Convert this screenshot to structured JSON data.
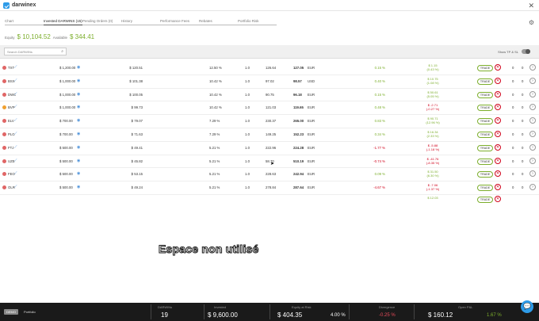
{
  "brand": {
    "name": "darwinex"
  },
  "tabs": [
    {
      "label": "Chart"
    },
    {
      "label": "Invested DARWINS (15)"
    },
    {
      "label": "Pending Orders (0)"
    },
    {
      "label": "History"
    },
    {
      "label": "Performance Fees"
    },
    {
      "label": "Rebates"
    },
    {
      "label": "Portfolio Risk"
    }
  ],
  "equity": {
    "label": "Equity",
    "value": "$ 10,104.52",
    "available_label": "Available",
    "available_value": "$ 344.41"
  },
  "toolbar": {
    "search_placeholder": "Search DARWINs",
    "show_tp_sl": "Show TP & SL"
  },
  "rows": [
    {
      "name": "TXT",
      "color": "#e06666",
      "amount": "$ 1,200.00",
      "invested": "$ 120.51",
      "pct": "12.50 %",
      "lev": "1.0",
      "p1": "126.64",
      "p2": "127.05",
      "ccy": "EUR",
      "perf": "0.15 %",
      "neg": false,
      "pnl1": "$ 1.15",
      "pnl2": "(0.43 %)",
      "c1": "0",
      "c2": "0"
    },
    {
      "name": "BSX",
      "color": "#e06666",
      "amount": "$ 1,000.00",
      "invested": "$ 101.38",
      "pct": "10.42 %",
      "lev": "1.0",
      "p1": "97.02",
      "p2": "98.57",
      "ccy": "USD",
      "perf": "0.40 %",
      "neg": false,
      "pnl1": "$ 10.75",
      "pnl2": "(1.08 %)",
      "c1": "0",
      "c2": "0"
    },
    {
      "name": "DWC",
      "color": "#e06666",
      "amount": "$ 1,000.00",
      "invested": "$ 100.05",
      "pct": "10.42 %",
      "lev": "1.0",
      "p1": "90.75",
      "p2": "96.18",
      "ccy": "EUR",
      "perf": "0.15 %",
      "neg": false,
      "pnl1": "$ 50.61",
      "pnl2": "(5.05 %)",
      "c1": "0",
      "c2": "0"
    },
    {
      "name": "BVP",
      "color": "#f0a030",
      "amount": "$ 1,000.00",
      "invested": "$ 99.73",
      "pct": "10.42 %",
      "lev": "1.0",
      "p1": "121.03",
      "p2": "119.65",
      "ccy": "EUR",
      "perf": "0.48 %",
      "neg": false,
      "pnl1": "$ -2.71",
      "pnl2": "(-0.27 %)",
      "c1": "0",
      "c2": "0"
    },
    {
      "name": "ELV",
      "color": "#e06666",
      "amount": "$ 700.00",
      "invested": "$ 79.07",
      "pct": "7.29 %",
      "lev": "1.0",
      "p1": "230.37",
      "p2": "265.00",
      "ccy": "EUR",
      "perf": "0.83 %",
      "neg": false,
      "pnl1": "$ 90.71",
      "pnl2": "(12.96 %)",
      "c1": "0",
      "c2": "0"
    },
    {
      "name": "PLG",
      "color": "#e06666",
      "amount": "$ 700.00",
      "invested": "$ 71.63",
      "pct": "7.29 %",
      "lev": "1.0",
      "p1": "149.25",
      "p2": "152.23",
      "ccy": "EUR",
      "perf": "0.34 %",
      "neg": false,
      "pnl1": "$ 16.34",
      "pnl2": "(2.33 %)",
      "c1": "0",
      "c2": "0"
    },
    {
      "name": "FTJ",
      "color": "#e06666",
      "amount": "$ 500.00",
      "invested": "$ 49.41",
      "pct": "5.21 %",
      "lev": "1.0",
      "p1": "222.96",
      "p2": "224.28",
      "ccy": "EUR",
      "perf": "-1.77 %",
      "neg": true,
      "pnl1": "$ -5.88",
      "pnl2": "(-1.18 %)",
      "c1": "0",
      "c2": "0"
    },
    {
      "name": "UZE",
      "color": "#e06666",
      "amount": "$ 500.00",
      "invested": "$ 45.82",
      "pct": "5.21 %",
      "lev": "1.0",
      "p1": "58.70",
      "p2": "510.19",
      "ccy": "EUR",
      "perf": "-0.74 %",
      "neg": true,
      "pnl1": "$ -41.76",
      "pnl2": "(-8.35 %)",
      "c1": "0",
      "c2": "0"
    },
    {
      "name": "FEO",
      "color": "#e06666",
      "amount": "$ 500.00",
      "invested": "$ 53.15",
      "pct": "5.21 %",
      "lev": "1.0",
      "p1": "228.63",
      "p2": "242.94",
      "ccy": "EUR",
      "perf": "0.09 %",
      "neg": false,
      "pnl1": "$ 31.50",
      "pnl2": "(6.30 %)",
      "c1": "0",
      "c2": "0"
    },
    {
      "name": "OLR",
      "color": "#e06666",
      "amount": "$ 500.00",
      "invested": "$ 49.24",
      "pct": "5.21 %",
      "lev": "1.0",
      "p1": "278.84",
      "p2": "287.64",
      "ccy": "EUR",
      "perf": "-4.67 %",
      "neg": true,
      "pnl1": "$ -7.06",
      "pnl2": "(-1.37 %)",
      "c1": "0",
      "c2": "0"
    }
  ],
  "partial_row": {
    "pnl1": "$ 12.03"
  },
  "trade_label": "TRADE",
  "overlay_text": "Espace non utilisé",
  "bottom": {
    "demo": "DEMO",
    "portfolio": "Portfolio",
    "stats": [
      {
        "label": "DARWINs",
        "value": "19",
        "cls": ""
      },
      {
        "label": "Invested",
        "value": "$ 9,600.00",
        "cls": ""
      },
      {
        "label": "Equity at Risk",
        "value": "$ 404.35",
        "value2": "4.00 %",
        "cls": ""
      },
      {
        "label": "Divergence",
        "value": "-0.25 %",
        "cls": "neg"
      },
      {
        "label": "Open P&L",
        "value": "$ 160.12",
        "value2": "1.67 %",
        "cls": "pos"
      }
    ]
  },
  "colors": {
    "accent": "#2e9be8",
    "positive": "#7cae2c",
    "negative": "#d0021b"
  }
}
